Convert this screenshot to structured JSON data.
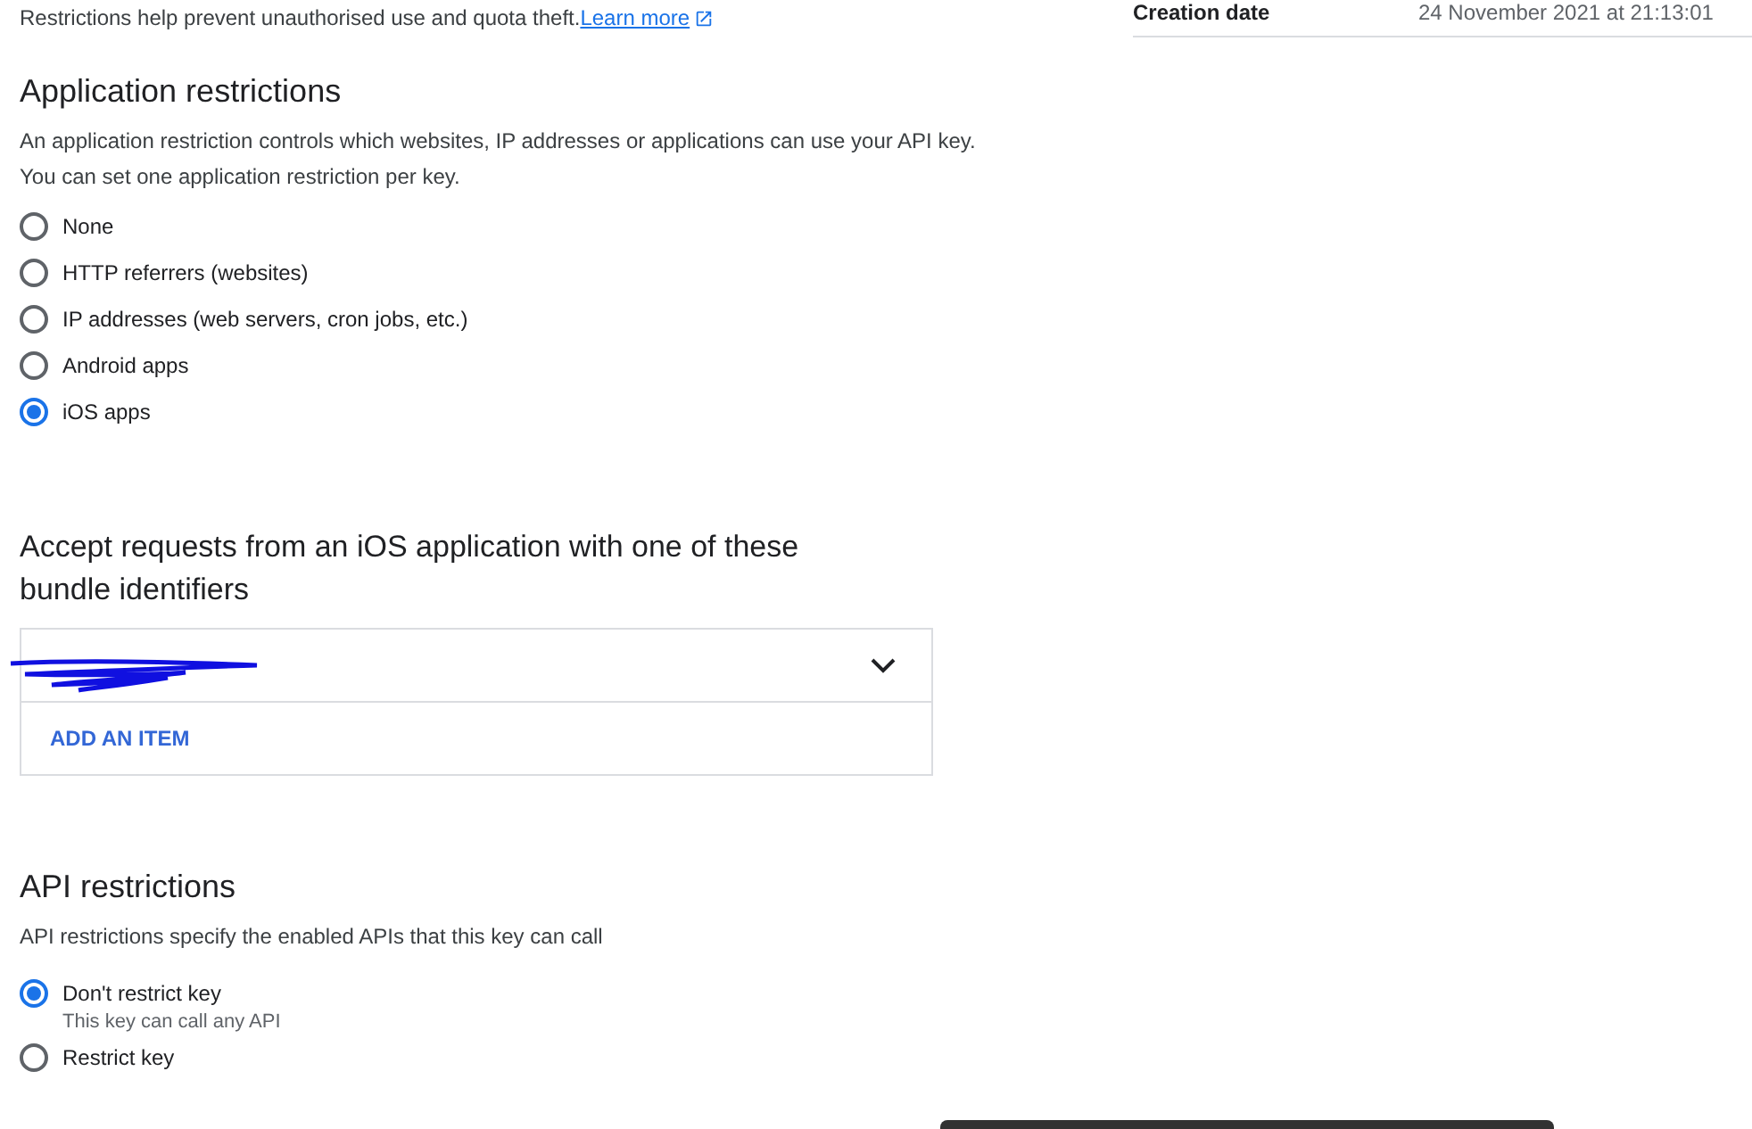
{
  "intro": {
    "text": "Restrictions help prevent unauthorised use and quota theft.",
    "link": "Learn more"
  },
  "details": {
    "label": "Creation date",
    "value": "24 November 2021 at 21:13:01"
  },
  "application_restrictions": {
    "title": "Application restrictions",
    "description": "An application restriction controls which websites, IP addresses or applications can use your API key. You can set one application restriction per key.",
    "options": [
      {
        "label": "None",
        "selected": false
      },
      {
        "label": "HTTP referrers (websites)",
        "selected": false
      },
      {
        "label": "IP addresses (web servers, cron jobs, etc.)",
        "selected": false
      },
      {
        "label": "Android apps",
        "selected": false
      },
      {
        "label": "iOS apps",
        "selected": true
      }
    ]
  },
  "ios": {
    "title": "Accept requests from an iOS application with one of these bundle identifiers",
    "add_button": "ADD AN ITEM"
  },
  "api_restrictions": {
    "title": "API restrictions",
    "description": "API restrictions specify the enabled APIs that this key can call",
    "options": [
      {
        "label": "Don't restrict key",
        "hint": "This key can call any API",
        "selected": true
      },
      {
        "label": "Restrict key",
        "selected": false
      }
    ]
  }
}
